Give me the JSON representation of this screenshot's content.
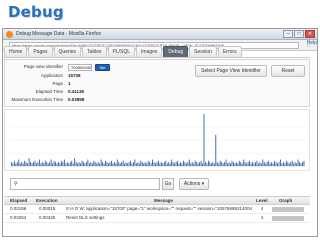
{
  "slide": {
    "title": "Debug"
  },
  "browser": {
    "window_title": "Debug Message Data - Mozilla Firefox",
    "controls": [
      "–",
      "□",
      "✕"
    ],
    "url": "https://apex.oracle.com/pls/apex/f?p=4000:OUTPUT:2231599390042:NO:OUTPUT:P19_PAGE_VIEW_ID:15706892940"
  },
  "help_label": "Help",
  "tabs": [
    {
      "label": "Home"
    },
    {
      "label": "Pages"
    },
    {
      "label": "Queries"
    },
    {
      "label": "Tables"
    },
    {
      "label": "PL/SQL"
    },
    {
      "label": "Images"
    },
    {
      "label": "Debug"
    },
    {
      "label": "Session"
    },
    {
      "label": "Errors"
    }
  ],
  "summary": {
    "page_view_label": "Page view identifier",
    "page_view_value": "700892940",
    "set_label": "Set",
    "fields": [
      {
        "label": "Application",
        "value": "15708"
      },
      {
        "label": "Page",
        "value": "1"
      },
      {
        "label": "Elapsed Time",
        "value": "0.41136"
      },
      {
        "label": "Maximum Execution Time",
        "value": "0.03898"
      }
    ],
    "select_button": "Select Page View Identifier",
    "reset_button": "Reset"
  },
  "chart_data": {
    "type": "bar",
    "values": [
      3,
      2,
      4,
      2,
      3,
      5,
      2,
      3,
      2,
      4,
      3,
      2,
      6,
      3,
      2,
      3,
      4,
      2,
      3,
      5,
      2,
      3,
      2,
      4,
      3,
      2,
      3,
      5,
      2,
      4,
      3,
      2,
      3,
      2,
      4,
      3,
      5,
      2,
      3,
      2,
      3,
      4,
      2,
      6,
      3,
      2,
      3,
      2,
      4,
      3,
      2,
      3,
      5,
      2,
      3,
      2,
      4,
      3,
      2,
      3,
      2,
      5,
      3,
      2,
      4,
      3,
      2,
      3,
      4,
      2,
      3,
      2,
      5,
      3,
      2,
      3,
      4,
      2,
      3,
      2,
      3,
      4,
      2,
      3,
      5,
      2,
      3,
      2,
      4,
      3,
      2,
      3,
      2,
      4,
      3,
      2,
      5,
      3,
      2,
      3,
      4,
      2,
      3,
      2,
      3,
      4,
      2,
      3,
      2,
      5,
      3,
      2,
      3,
      4,
      2,
      3,
      2,
      4,
      3,
      2,
      3,
      5,
      2,
      3,
      2,
      4,
      3,
      2,
      3,
      4,
      2,
      40,
      3,
      2,
      4,
      3,
      2,
      3,
      2,
      24,
      3,
      2,
      4,
      3,
      2,
      3,
      5,
      2,
      3,
      2,
      4,
      3,
      2,
      3,
      2,
      4,
      3,
      2,
      5,
      3,
      2,
      3,
      4,
      2,
      3,
      2,
      3,
      4,
      2,
      3,
      2,
      5,
      3,
      2,
      3,
      4,
      2,
      3,
      2,
      4,
      3,
      2,
      3,
      5,
      2,
      3,
      2,
      4,
      3,
      2,
      3,
      4,
      2,
      3,
      2,
      5,
      3,
      2,
      3,
      4
    ],
    "bar_color": "#2e5fa8",
    "grid": true
  },
  "filter": {
    "query": "",
    "go_label": "Go",
    "actions_label": "Actions ▾"
  },
  "table": {
    "columns": [
      "Elapsed",
      "Execution",
      "Message",
      "Level",
      "Graph"
    ],
    "rows": [
      {
        "elapsed": "0.03196",
        "execution": "0.00015",
        "message": "S H O W: application=\"15700\" page=\"1\" workspace=\"\" request=\"\" session=\"10578689314004\"",
        "level": "4"
      },
      {
        "elapsed": "0.03254",
        "execution": "0.00425",
        "message": "Reset NLS settings",
        "level": "4"
      }
    ]
  }
}
